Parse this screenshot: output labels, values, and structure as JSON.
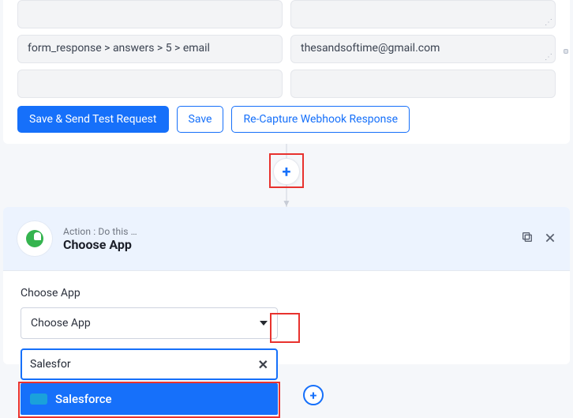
{
  "top": {
    "rows": [
      {
        "left": "",
        "right": ""
      },
      {
        "left": "form_response > answers > 5 > email",
        "right": "thesandsoftime@gmail.com"
      }
    ],
    "buttons": {
      "save_send": "Save & Send Test Request",
      "save": "Save",
      "recapture": "Re-Capture Webhook Response"
    }
  },
  "action": {
    "kicker": "Action : Do this …",
    "title": "Choose App",
    "section_label": "Choose App",
    "select_placeholder": "Choose App",
    "search_value": "Salesfor",
    "result_label": "Salesforce"
  }
}
